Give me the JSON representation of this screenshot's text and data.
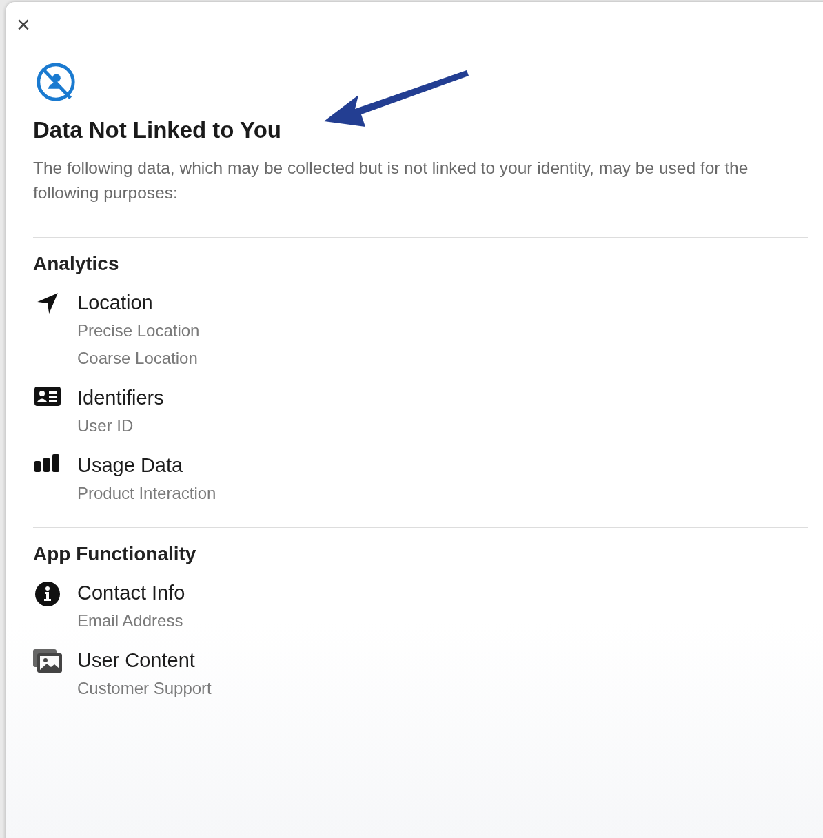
{
  "close_button": {
    "label": "×"
  },
  "header": {
    "title": "Data Not Linked to You",
    "description": "The following data, which may be collected but is not linked to your identity, may be used for the following purposes:"
  },
  "sections": [
    {
      "title": "Analytics",
      "items": [
        {
          "kind": "location",
          "label": "Location",
          "details": [
            "Precise Location",
            "Coarse Location"
          ]
        },
        {
          "kind": "identifiers",
          "label": "Identifiers",
          "details": [
            "User ID"
          ]
        },
        {
          "kind": "usage",
          "label": "Usage Data",
          "details": [
            "Product Interaction"
          ]
        }
      ]
    },
    {
      "title": "App Functionality",
      "items": [
        {
          "kind": "contact",
          "label": "Contact Info",
          "details": [
            "Email Address"
          ]
        },
        {
          "kind": "content",
          "label": "User Content",
          "details": [
            "Customer Support"
          ]
        }
      ]
    }
  ]
}
